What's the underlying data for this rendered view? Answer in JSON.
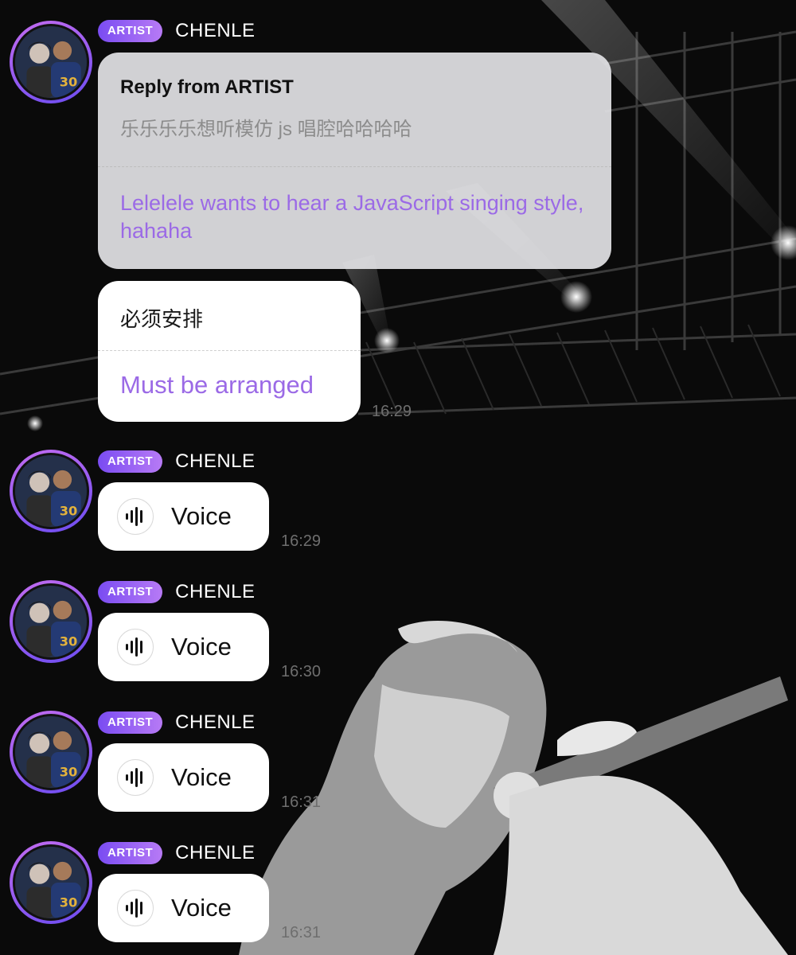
{
  "colors": {
    "badge_start": "#7a4cf2",
    "badge_end": "#b77af5",
    "translation_text": "#9b6ae6",
    "timestamp": "#6e6e6e"
  },
  "messages": [
    {
      "badge": "ARTIST",
      "sender": "CHENLE",
      "reply": {
        "title": "Reply from ARTIST",
        "original": "乐乐乐乐想听模仿 js 唱腔哈哈哈哈",
        "translation": "Lelelele wants to hear a JavaScript singing style, hahaha"
      },
      "text": {
        "original": "必须安排",
        "translation": "Must be arranged"
      },
      "time": "16:29"
    },
    {
      "badge": "ARTIST",
      "sender": "CHENLE",
      "type": "voice",
      "label": "Voice",
      "icon": "waveform-icon",
      "time": "16:29"
    },
    {
      "badge": "ARTIST",
      "sender": "CHENLE",
      "type": "voice",
      "label": "Voice",
      "icon": "waveform-icon",
      "time": "16:30"
    },
    {
      "badge": "ARTIST",
      "sender": "CHENLE",
      "type": "voice",
      "label": "Voice",
      "icon": "waveform-icon",
      "time": "16:31"
    },
    {
      "badge": "ARTIST",
      "sender": "CHENLE",
      "type": "voice",
      "label": "Voice",
      "icon": "waveform-icon",
      "time": "16:31"
    }
  ]
}
